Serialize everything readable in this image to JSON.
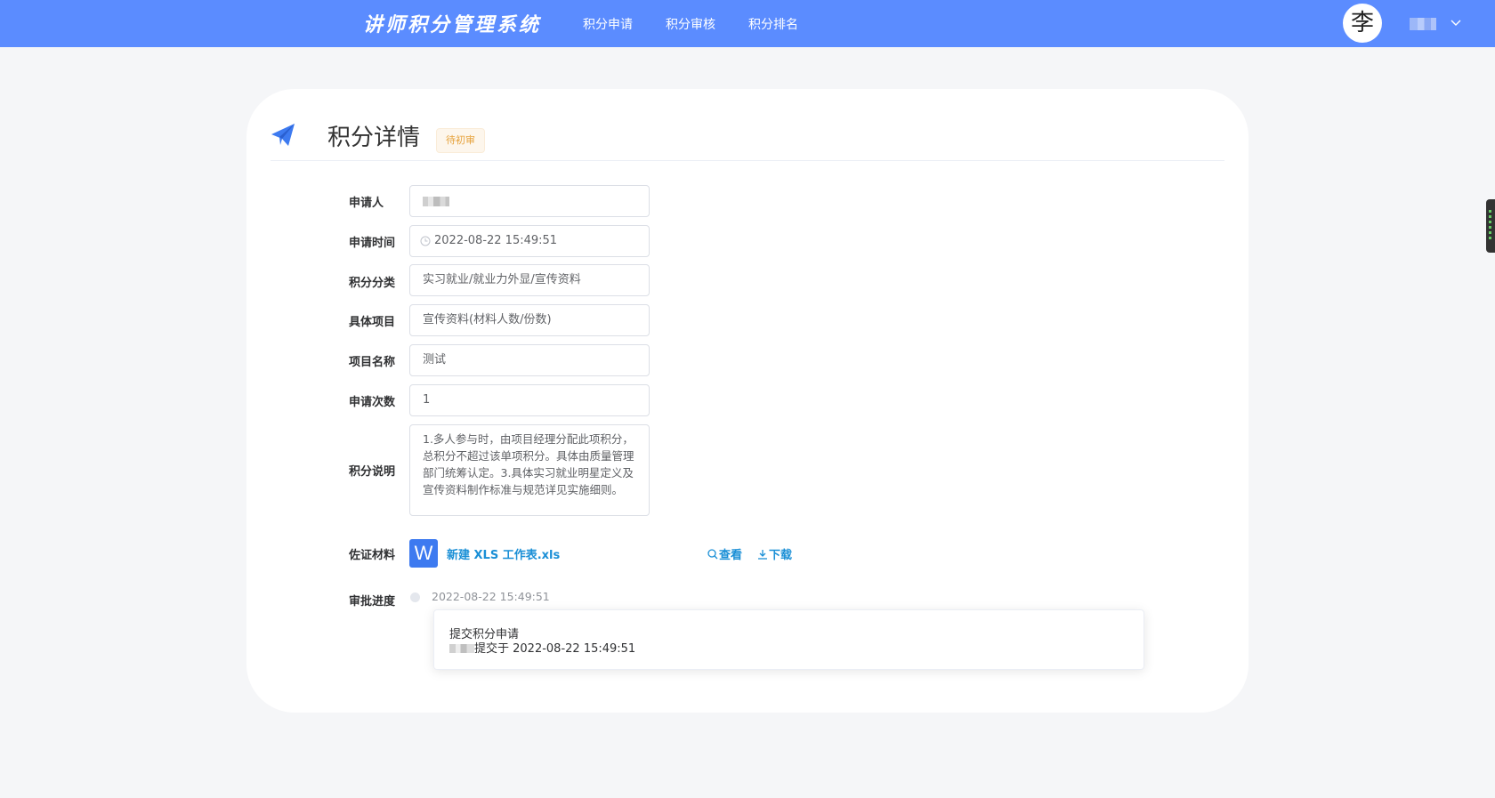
{
  "header": {
    "brand": "讲师积分管理系统",
    "nav": [
      "积分申请",
      "积分审核",
      "积分排名"
    ],
    "avatar_text": "李",
    "accent_color": "#5b8cff"
  },
  "card": {
    "title": "积分详情",
    "status": "待初审",
    "icon": "paper-plane-icon"
  },
  "form": {
    "applicant": {
      "label": "申请人"
    },
    "apply_time": {
      "label": "申请时间",
      "value": "2022-08-22 15:49:51"
    },
    "category": {
      "label": "积分分类",
      "value": "实习就业/就业力外显/宣传资料"
    },
    "item": {
      "label": "具体项目",
      "value": "宣传资料(材料人数/份数)"
    },
    "project_name": {
      "label": "项目名称",
      "value": "测试"
    },
    "apply_count": {
      "label": "申请次数",
      "value": "1"
    },
    "description": {
      "label": "积分说明",
      "value": "1.多人参与时，由项目经理分配此项积分，总积分不超过该单项积分。具体由质量管理部门统筹认定。3.具体实习就业明星定义及宣传资料制作标准与规范详见实施细则。"
    },
    "evidence": {
      "label": "佐证材料",
      "file_icon_letter": "W",
      "file_name": "新建 XLS 工作表.xls",
      "view_label": "查看",
      "download_label": "下载"
    },
    "progress": {
      "label": "审批进度",
      "time": "2022-08-22 15:49:51",
      "title": "提交积分申请",
      "detail": "提交于 2022-08-22 15:49:51"
    }
  }
}
